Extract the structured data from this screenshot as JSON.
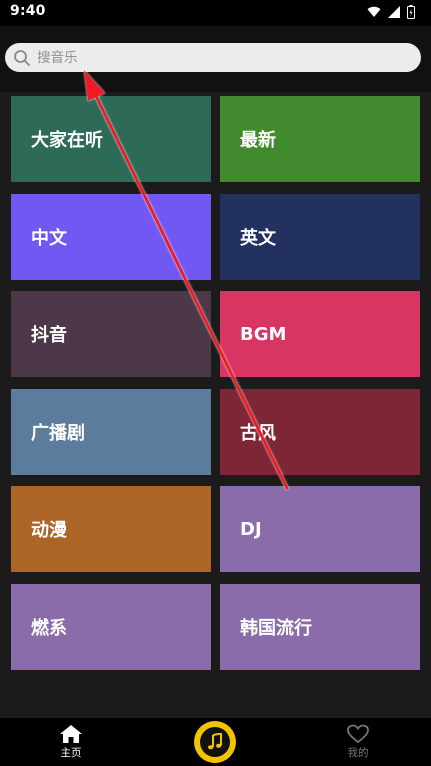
{
  "status_bar": {
    "time": "9:40",
    "icons": [
      "wifi-icon",
      "signal-icon",
      "battery-icon"
    ]
  },
  "search": {
    "placeholder": "搜音乐",
    "value": ""
  },
  "categories": [
    {
      "label": "大家在听",
      "color": "#2d6b58"
    },
    {
      "label": "最新",
      "color": "#418a2d"
    },
    {
      "label": "中文",
      "color": "#7258f2"
    },
    {
      "label": "英文",
      "color": "#22315f"
    },
    {
      "label": "抖音",
      "color": "#4c3848"
    },
    {
      "label": "BGM",
      "color": "#d83562"
    },
    {
      "label": "广播剧",
      "color": "#5c7c9d"
    },
    {
      "label": "古风",
      "color": "#7c2636"
    },
    {
      "label": "动漫",
      "color": "#ac6427"
    },
    {
      "label": "DJ",
      "color": "#8b6cab"
    },
    {
      "label": "燃系",
      "color": "#8b6cab"
    },
    {
      "label": "韩国流行",
      "color": "#8b6cab"
    }
  ],
  "bottom_nav": {
    "home_label": "主页",
    "player_icon": "music-note-icon",
    "mine_label": "我的"
  },
  "annotation": {
    "type": "arrow",
    "color": "#ee1c24"
  }
}
